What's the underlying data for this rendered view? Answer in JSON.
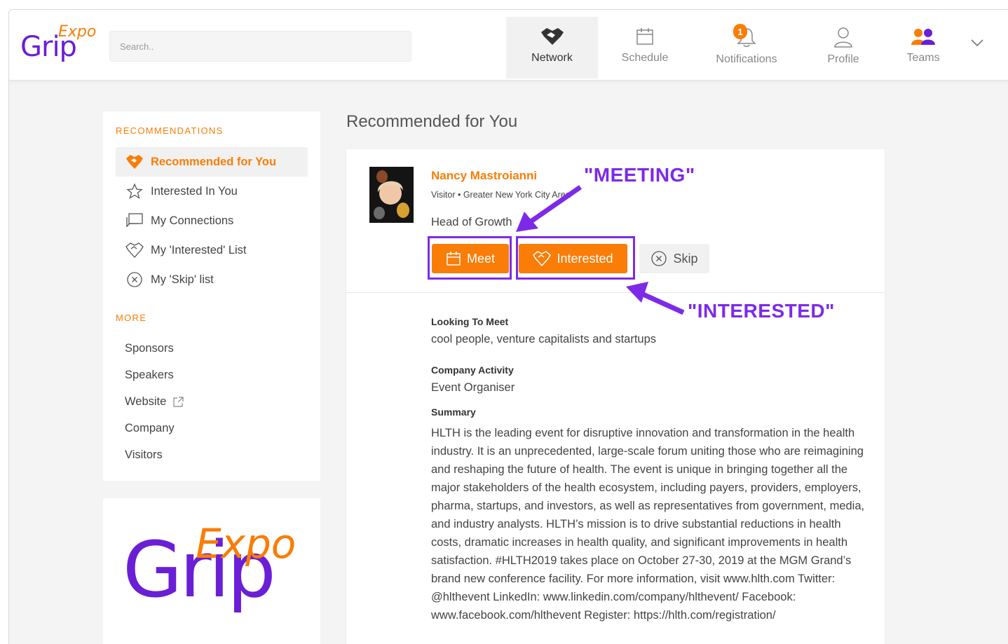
{
  "brand": {
    "logo_word": "Grip",
    "logo_sup": "Expo",
    "purple": "#6a1fd6",
    "orange": "#f97d07"
  },
  "search": {
    "placeholder": "Search.."
  },
  "nav": {
    "network": "Network",
    "schedule": "Schedule",
    "notifications": "Notifications",
    "notifications_badge": "1",
    "profile": "Profile",
    "teams": "Teams"
  },
  "sidebar": {
    "recommendations_title": "RECOMMENDATIONS",
    "items": [
      {
        "label": "Recommended for You",
        "icon": "handshake-icon",
        "active": true
      },
      {
        "label": "Interested In You",
        "icon": "star-icon"
      },
      {
        "label": "My Connections",
        "icon": "chat-icon"
      },
      {
        "label": "My 'Interested' List",
        "icon": "handshake-outline-icon"
      },
      {
        "label": "My 'Skip' list",
        "icon": "circle-x-icon"
      }
    ],
    "more_title": "MORE",
    "more_items": [
      "Sponsors",
      "Speakers",
      "Website",
      "Company",
      "Visitors"
    ]
  },
  "main": {
    "title": "Recommended for You",
    "profile": {
      "name": "Nancy Mastroianni",
      "meta": "Visitor • Greater New York City Area",
      "job_title": "Head of Growth",
      "buttons": {
        "meet": "Meet",
        "interested": "Interested",
        "skip": "Skip"
      },
      "looking_to_meet_label": "Looking To Meet",
      "looking_to_meet": "cool people, venture capitalists and startups",
      "company_activity_label": "Company Activity",
      "company_activity": "Event Organiser",
      "summary_label": "Summary",
      "summary": "HLTH is the leading event for disruptive innovation and transformation in the health industry. It is an unprecedented, large-scale forum uniting those who are reimagining and reshaping the future of health. The event is unique in bringing together all the major stakeholders of the health ecosystem, including payers, providers, employers, pharma, startups, and investors, as well as representatives from government, media, and industry analysts. HLTH’s mission is to drive substantial reductions in health costs, dramatic increases in health quality, and significant improvements in health satisfaction. #HLTH2019 takes place on October 27-30, 2019 at the MGM Grand’s brand new conference facility. For more information, visit www.hlth.com Twitter: @hlthevent LinkedIn: www.linkedin.com/company/hlthevent/ Facebook: www.facebook.com/hlthevent Register: https://hlth.com/registration/"
    }
  },
  "annotations": {
    "meeting": "\"MEETING\"",
    "interested": "\"INTERESTED\"",
    "color": "#7d2ae8"
  }
}
